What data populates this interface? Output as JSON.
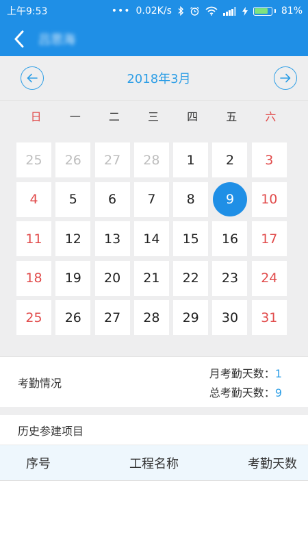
{
  "status_bar": {
    "time": "上午9:53",
    "network_speed": "0.02K/s",
    "battery_percent": "81%",
    "icons": [
      "bluetooth-icon",
      "alarm-icon",
      "wifi-icon",
      "signal-icon",
      "charging-icon",
      "battery-icon"
    ]
  },
  "app_bar": {
    "title": "吕思海",
    "back_icon": "chevron-left-icon",
    "color": "#1f8fe6"
  },
  "calendar": {
    "month_title": "2018年3月",
    "prev_icon": "arrow-left-circle-icon",
    "next_icon": "arrow-right-circle-icon",
    "weekdays": [
      "日",
      "一",
      "二",
      "三",
      "四",
      "五",
      "六"
    ],
    "selected_day": "9",
    "weeks": [
      [
        "25",
        "26",
        "27",
        "28",
        "1",
        "2",
        "3"
      ],
      [
        "4",
        "5",
        "6",
        "7",
        "8",
        "9",
        "10"
      ],
      [
        "11",
        "12",
        "13",
        "14",
        "15",
        "16",
        "17"
      ],
      [
        "18",
        "19",
        "20",
        "21",
        "22",
        "23",
        "24"
      ],
      [
        "25",
        "26",
        "27",
        "28",
        "29",
        "30",
        "31"
      ]
    ],
    "colors": {
      "accent": "#2d9ee6",
      "weekend": "#e14b4b",
      "muted": "#bdbdbd"
    }
  },
  "attendance": {
    "label": "考勤情况",
    "monthly_label": "月考勤天数：",
    "monthly_value": "1",
    "total_label": "总考勤天数：",
    "total_value": "9"
  },
  "history": {
    "title": "历史参建项目",
    "columns": [
      "序号",
      "工程名称",
      "考勤天数"
    ],
    "header_bg": "#eef7fd"
  }
}
